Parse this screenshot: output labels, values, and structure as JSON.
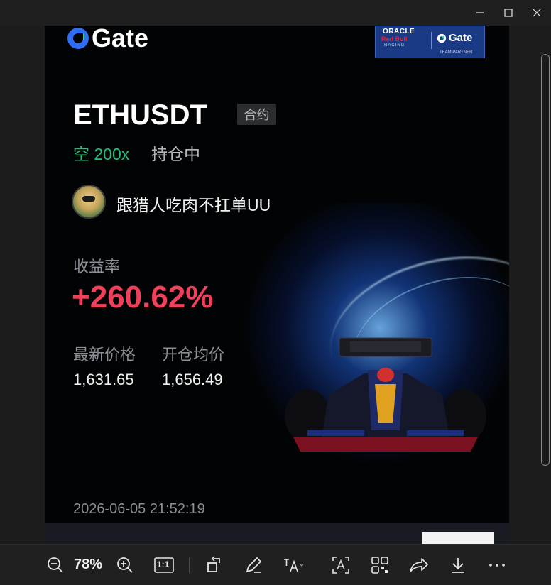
{
  "window": {
    "controls": [
      "minimize-icon",
      "maximize-icon",
      "close-icon"
    ]
  },
  "card": {
    "brand": "Gate",
    "partner_badge": {
      "line1": "ORACLE",
      "line2": "Red Bull",
      "line3": "RACING",
      "brand": "Gate",
      "caption": "TEAM PARTNER"
    },
    "pair": "ETHUSDT",
    "contract_tag": "合约",
    "direction": "空 200x",
    "position_status": "持仓中",
    "username": "跟猎人吃肉不扛单UU",
    "return_label": "收益率",
    "return_value": "+260.62%",
    "latest_price_label": "最新价格",
    "open_avg_price_label": "开仓均价",
    "latest_price": "1,631.65",
    "open_avg_price": "1,656.49",
    "timestamp": "2026-06-05 21:52:19",
    "colors": {
      "long_short": "#22c17c",
      "profit": "#f0405c",
      "background": "#020304"
    }
  },
  "toolbar": {
    "zoom_level": "78%",
    "actual_size": "1:1",
    "icons": [
      "zoom-out-icon",
      "zoom-in-icon",
      "actual-size-icon",
      "rotate-icon",
      "edit-icon",
      "text-recognition-icon",
      "text-select-icon",
      "qr-scan-icon",
      "share-icon",
      "download-icon",
      "more-icon"
    ]
  }
}
